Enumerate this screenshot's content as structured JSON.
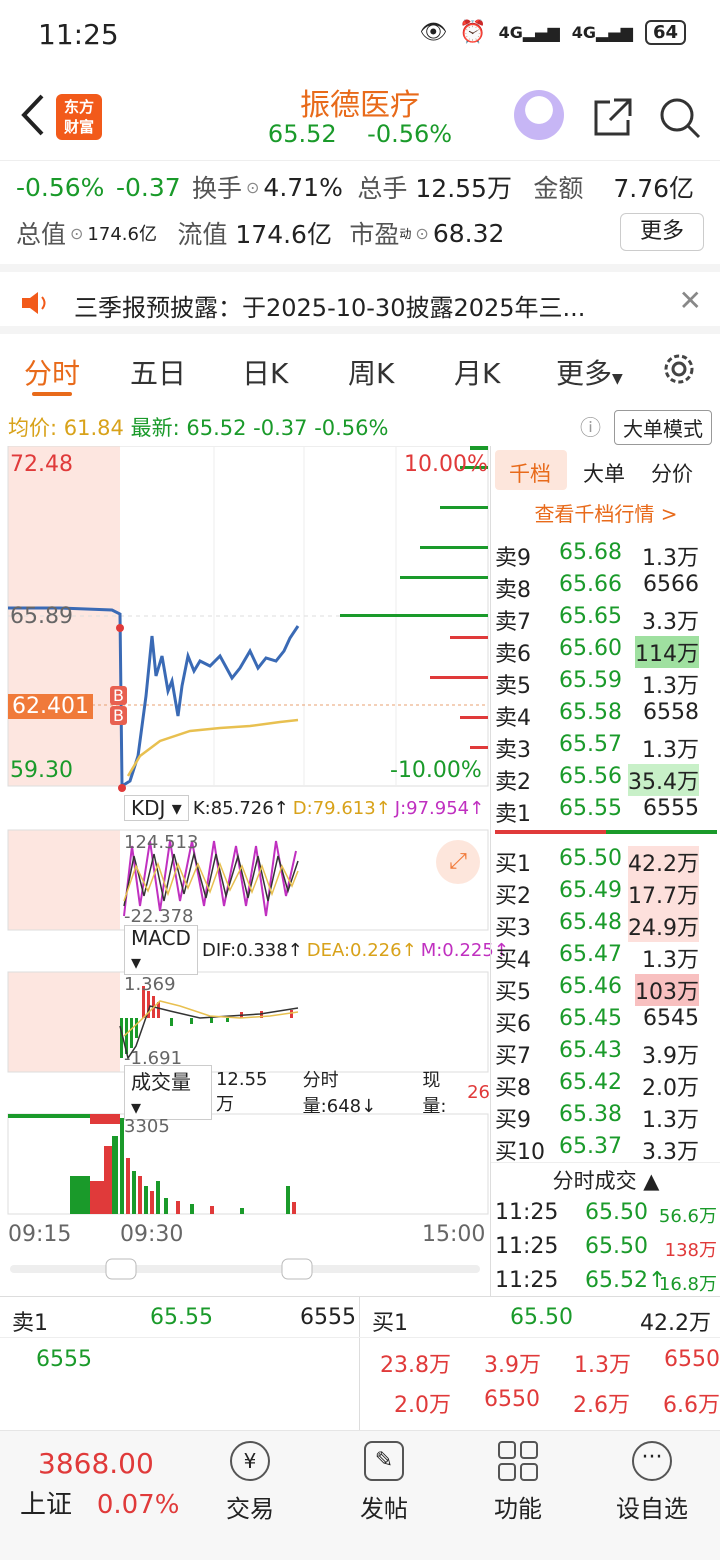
{
  "status_bar": {
    "time": "11:25",
    "signal1": "4G",
    "signal2": "4G",
    "battery": "64"
  },
  "header": {
    "title": "振德医疗",
    "price": "65.52",
    "change_pct": "-0.56%",
    "logo_line1": "东方",
    "logo_line2": "财富"
  },
  "summary": {
    "change_pct": "-0.56%",
    "change": "-0.37",
    "turnover_label": "换手",
    "turnover": "4.71%",
    "volume_label": "总手",
    "volume": "12.55万",
    "amount_label": "金额",
    "amount": "7.76亿",
    "mktcap_label": "总值",
    "mktcap": "174.6亿",
    "float_label": "流值",
    "float": "174.6亿",
    "pe_label": "市盈",
    "pe_sup": "动",
    "pe": "68.32",
    "more": "更多"
  },
  "notice": {
    "text": "三季报预披露：于2025-10-30披露2025年三..."
  },
  "tabs": [
    "分时",
    "五日",
    "日K",
    "周K",
    "月K",
    "更多",
    ""
  ],
  "price_line": {
    "avg_label": "均价:",
    "avg": "61.84",
    "latest_label": "最新:",
    "latest": "65.52",
    "change": "-0.37",
    "change_pct": "-0.56%",
    "big_order_mode": "大单模式"
  },
  "chart": {
    "y_max": "72.48",
    "y_min": "59.30",
    "pct_max": "10.00%",
    "pct_min": "-10.00%",
    "ref_price": "65.89",
    "marker_price": "62.401",
    "marker_b": "B",
    "kdj": {
      "name": "KDJ",
      "k": "K:85.726↑",
      "d": "D:79.613↑",
      "j": "J:97.954↑",
      "hi": "124.513",
      "lo": "-22.378"
    },
    "macd": {
      "name": "MACD",
      "dif": "DIF:0.338↑",
      "dea": "DEA:0.226↑",
      "m": "M:0.225↑",
      "hi": "1.369",
      "lo": "-1.691"
    },
    "vol": {
      "name": "成交量",
      "total": "12.55万",
      "min_vol": "分时量:648↓",
      "now_label": "现量:",
      "now": "26",
      "peak": "3305"
    },
    "x_start": "09:15",
    "x_mid": "09:30",
    "x_end": "15:00"
  },
  "book": {
    "tabs": [
      "千档",
      "大单",
      "分价"
    ],
    "link": "查看千档行情 >",
    "asks": [
      {
        "label": "卖9",
        "price": "65.68",
        "vol": "1.3万"
      },
      {
        "label": "卖8",
        "price": "65.66",
        "vol": "6566"
      },
      {
        "label": "卖7",
        "price": "65.65",
        "vol": "3.3万"
      },
      {
        "label": "卖6",
        "price": "65.60",
        "vol": "114万"
      },
      {
        "label": "卖5",
        "price": "65.59",
        "vol": "1.3万"
      },
      {
        "label": "卖4",
        "price": "65.58",
        "vol": "6558"
      },
      {
        "label": "卖3",
        "price": "65.57",
        "vol": "1.3万"
      },
      {
        "label": "卖2",
        "price": "65.56",
        "vol": "35.4万"
      },
      {
        "label": "卖1",
        "price": "65.55",
        "vol": "6555"
      }
    ],
    "bids": [
      {
        "label": "买1",
        "price": "65.50",
        "vol": "42.2万"
      },
      {
        "label": "买2",
        "price": "65.49",
        "vol": "17.7万"
      },
      {
        "label": "买3",
        "price": "65.48",
        "vol": "24.9万"
      },
      {
        "label": "买4",
        "price": "65.47",
        "vol": "1.3万"
      },
      {
        "label": "买5",
        "price": "65.46",
        "vol": "103万"
      },
      {
        "label": "买6",
        "price": "65.45",
        "vol": "6545"
      },
      {
        "label": "买7",
        "price": "65.43",
        "vol": "3.9万"
      },
      {
        "label": "买8",
        "price": "65.42",
        "vol": "2.0万"
      },
      {
        "label": "买9",
        "price": "65.38",
        "vol": "1.3万"
      },
      {
        "label": "买10",
        "price": "65.37",
        "vol": "3.3万"
      }
    ],
    "trades_title": "分时成交",
    "trades": [
      {
        "time": "11:25",
        "price": "65.50",
        "vol": "56.6万"
      },
      {
        "time": "11:25",
        "price": "65.50",
        "vol": "138万"
      },
      {
        "time": "11:25",
        "price": "65.52↑",
        "vol": "16.8万"
      }
    ]
  },
  "bottom": {
    "sell_label": "卖1",
    "sell_price": "65.55",
    "sell_vol": "6555",
    "sell_detail": "6555",
    "buy_label": "买1",
    "buy_price": "65.50",
    "buy_vol": "42.2万",
    "buy_detail_row1": [
      "23.8万",
      "3.9万",
      "1.3万",
      "6550"
    ],
    "buy_detail_row2": [
      "2.0万",
      "6550",
      "2.6万",
      "6.6万"
    ]
  },
  "nav": {
    "index_value": "3868.00",
    "index_name": "上证",
    "index_change": "0.07%",
    "items": [
      "交易",
      "发帖",
      "功能",
      "设自选"
    ]
  }
}
